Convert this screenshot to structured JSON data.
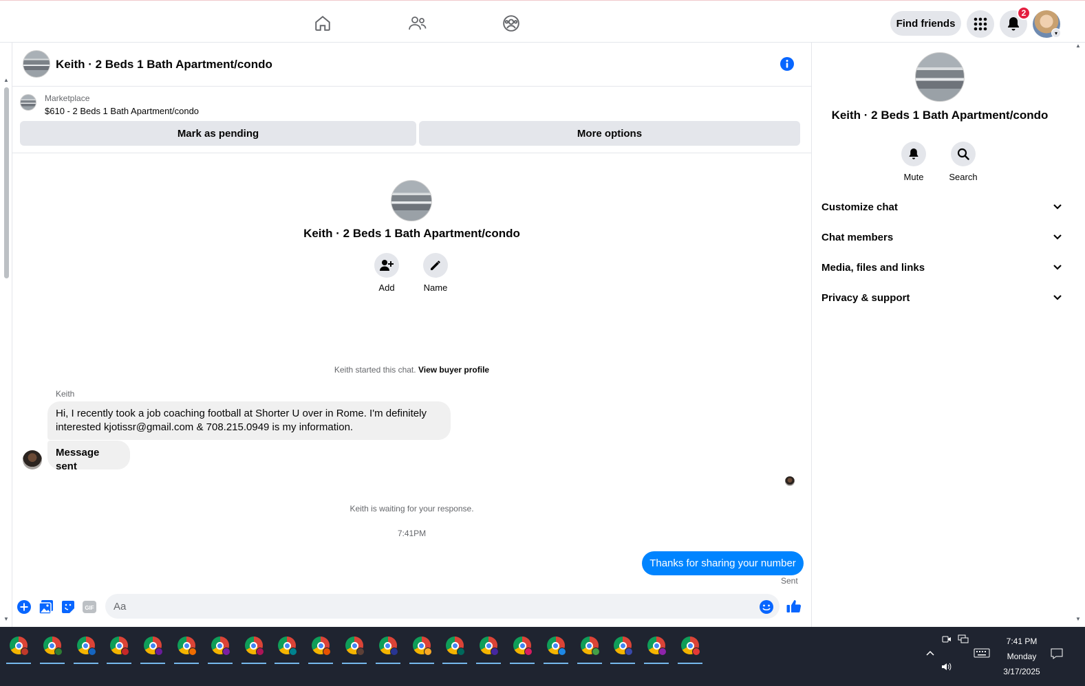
{
  "nav": {
    "find_friends": "Find friends",
    "notification_count": "2"
  },
  "chat": {
    "title": "Keith · 2 Beds 1 Bath Apartment/condo"
  },
  "marketplace": {
    "label": "Marketplace",
    "item": "$610 - 2 Beds 1 Bath Apartment/condo",
    "mark_pending": "Mark as pending",
    "more_options": "More options"
  },
  "conversation": {
    "title": "Keith · 2 Beds 1 Bath Apartment/condo",
    "add_label": "Add",
    "name_label": "Name",
    "started_text": "Keith started this chat.",
    "view_buyer_profile": "View buyer profile",
    "sender_name": "Keith",
    "message_1": "Hi, I recently took a job coaching football at Shorter U over in Rome. I'm definitely interested kjotissr@gmail.com & 708.215.0949 is my information.",
    "message_2": "Message sent",
    "waiting": "Keith is waiting for your response.",
    "timestamp": "7:41PM",
    "outgoing": "Thanks for sharing your number",
    "sent": "Sent"
  },
  "composer": {
    "placeholder": "Aa"
  },
  "right_panel": {
    "title": "Keith · 2 Beds 1 Bath Apartment/condo",
    "mute": "Mute",
    "search": "Search",
    "sections": [
      "Customize chat",
      "Chat members",
      "Media, files and links",
      "Privacy & support"
    ]
  },
  "taskbar": {
    "app_badge_colors": [
      "#c0392b",
      "#2e7d32",
      "#1565c0",
      "#c62828",
      "#6a1b9a",
      "#ef6c00",
      "#7b1fa2",
      "#ad1457",
      "#00838f",
      "#e65100",
      "#5d4037",
      "#283593",
      "#f9a825",
      "#00695c",
      "#4527a0",
      "#d81b60",
      "#1e88e5",
      "#43a047",
      "#3949ab",
      "#8e24aa",
      "#e53935"
    ],
    "time": "7:41 PM",
    "day": "Monday",
    "date": "3/17/2025"
  },
  "colors": {
    "accent": "#0084ff",
    "gray_button": "#e4e6eb",
    "badge": "#e41e3f"
  }
}
